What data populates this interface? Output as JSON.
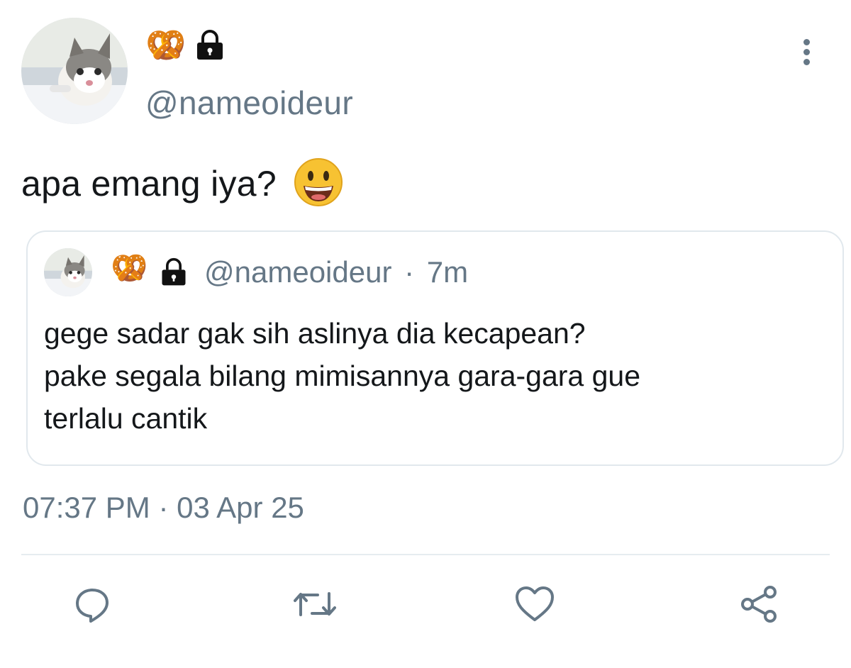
{
  "tweet": {
    "user": {
      "emoji": "🥨",
      "handle": "@nameoideur",
      "avatar_icon": "cat-avatar",
      "locked_icon": "lock-icon"
    },
    "text": "apa emang iya?",
    "text_emoji": "smiley-face-emoji",
    "timestamp": "07:37 PM · 03 Apr 25"
  },
  "quote": {
    "emoji": "🥨",
    "handle": "@nameoideur",
    "separator": "·",
    "time": "7m",
    "text": "gege sadar gak sih aslinya dia kecapean?\npake segala bilang mimisannya gara-gara gue\nterlalu cantik"
  },
  "actions": [
    {
      "name": "reply",
      "icon": "reply-icon"
    },
    {
      "name": "retweet",
      "icon": "retweet-icon"
    },
    {
      "name": "like",
      "icon": "heart-icon"
    },
    {
      "name": "share",
      "icon": "share-icon"
    }
  ],
  "colors": {
    "secondary_text": "#657786",
    "primary_text": "#14171a",
    "border": "#e1e8ed"
  }
}
